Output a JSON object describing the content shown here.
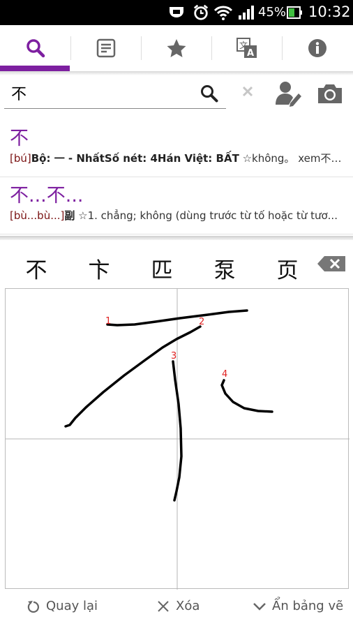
{
  "status_bar": {
    "battery_percent": "45%",
    "time": "10:32"
  },
  "tabs": [
    {
      "icon": "search-icon",
      "active": true
    },
    {
      "icon": "notes-icon",
      "active": false
    },
    {
      "icon": "star-icon",
      "active": false
    },
    {
      "icon": "translate-icon",
      "active": false
    },
    {
      "icon": "info-icon",
      "active": false
    }
  ],
  "accent_color": "#7d1fa0",
  "search": {
    "value": "不",
    "placeholder": ""
  },
  "results": [
    {
      "word": "不",
      "pinyin": "[bú]",
      "bold_text": "Bộ: 一 - NhấtSố nét: 4Hán Việt: BẤT",
      "rest_text": " ☆không。 xem不\"bù..."
    },
    {
      "word": "不...不...",
      "pinyin": "[bù...bù...]",
      "bold_text": "副",
      "rest_text": " ☆1. chẳng; không (dùng trước từ tố hoặc từ tươ..."
    }
  ],
  "candidates": [
    "不",
    "卞",
    "匹",
    "泵",
    "页"
  ],
  "stroke_numbers": [
    "1",
    "2",
    "3",
    "4"
  ],
  "bottom_bar": {
    "back_label": "Quay lại",
    "clear_label": "Xóa",
    "hide_label": "Ẩn bảng vẽ"
  }
}
